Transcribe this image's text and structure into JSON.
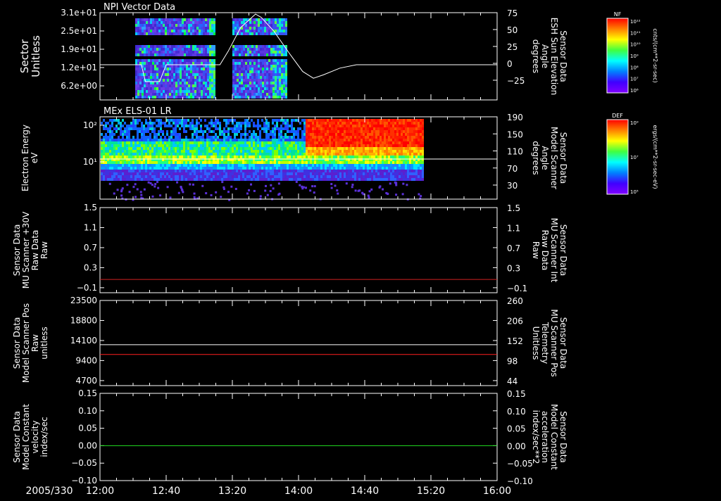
{
  "chart_data": [
    {
      "type": "heatmap",
      "title": "NPI Vector Data",
      "ylabel": [
        "Sector",
        "Unitless"
      ],
      "yticks": [
        "3.1e+01",
        "2.5e+01",
        "1.9e+01",
        "1.2e+01",
        "6.2e+00"
      ],
      "y2ticks": [
        "75",
        "50",
        "25",
        "0",
        "−25"
      ],
      "y2label": [
        "Sensor Data",
        "ESH Sun Elevation",
        "Angle",
        "degrees"
      ],
      "y2color": "#ffffff",
      "colorbar": {
        "title": "NF",
        "ticks": [
          "10¹²",
          "10¹¹",
          "10¹⁰",
          "10⁹",
          "10⁸",
          "10⁷",
          "10⁶"
        ],
        "label": "cnts/(cm**2-sr-sec)"
      },
      "line_series": {
        "name": "ESH Sun Elevation Angle",
        "color": "#ffffff",
        "points": [
          [
            0,
            0
          ],
          [
            50,
            0
          ],
          [
            55,
            -25
          ],
          [
            72,
            -25
          ],
          [
            80,
            0
          ],
          [
            145,
            0
          ],
          [
            155,
            20
          ],
          [
            170,
            55
          ],
          [
            188,
            75
          ],
          [
            195,
            70
          ],
          [
            210,
            50
          ],
          [
            230,
            15
          ],
          [
            245,
            -10
          ],
          [
            258,
            -20
          ],
          [
            270,
            -15
          ],
          [
            290,
            -5
          ],
          [
            310,
            0
          ],
          [
            480,
            0
          ]
        ]
      },
      "time_range_min": [
        720,
        960
      ]
    },
    {
      "type": "heatmap",
      "title": "MEx ELS-01 LR",
      "ylabel": [
        "Electron Energy",
        "eV"
      ],
      "yticks": [
        "10²",
        "10¹"
      ],
      "y2ticks": [
        "190",
        "150",
        "110",
        "70",
        "30"
      ],
      "y2label": [
        "Sensor Data",
        "Model Scanner",
        "Angle",
        "degrees"
      ],
      "y2color": "#ffffff",
      "colorbar": {
        "title": "DEF",
        "ticks": [
          "10⁹",
          "10⁷",
          "10⁵"
        ],
        "label": "ergs/(cm**2-sr-sec-eV)"
      },
      "line_series": {
        "name": "Model Scanner Angle",
        "color": "#ffffff",
        "value": 90,
        "range": [
          10,
          190
        ]
      }
    },
    {
      "type": "line",
      "ylabel": [
        "Sensor Data",
        "MU Scanner +30V",
        "Raw Data",
        "Raw"
      ],
      "yticks": [
        "1.5",
        "1.1",
        "0.7",
        "0.3",
        "−0.1"
      ],
      "y2ticks": [
        "1.5",
        "1.1",
        "0.7",
        "0.3",
        "−0.1"
      ],
      "y2label": [
        "Sensor Data",
        "MU Scanner Int",
        "Raw Data",
        "Raw"
      ],
      "y2color": "#ff2020",
      "ylim": [
        -0.3,
        1.5
      ],
      "series": [
        {
          "color": "#d02020",
          "value": -0.02
        }
      ]
    },
    {
      "type": "line",
      "ylabel": [
        "Sensor Data",
        "Model Scanner Pos",
        "Raw",
        "unitless"
      ],
      "yticks": [
        "23500",
        "18800",
        "14100",
        "9400",
        "4700"
      ],
      "y2ticks": [
        "260",
        "206",
        "152",
        "98",
        "44"
      ],
      "y2label": [
        "Sensor Data",
        "MU Scanner Pos",
        "Telemetry",
        "Unitless"
      ],
      "y2color": "#ff2020",
      "ylim": [
        0,
        23500
      ],
      "series": [
        {
          "color": "#ffffff",
          "value": 11300
        },
        {
          "color": "#ff2020",
          "value": 8600
        }
      ]
    },
    {
      "type": "line",
      "ylabel": [
        "Sensor Data",
        "Model Constant",
        "velocity",
        "index/sec"
      ],
      "yticks": [
        "0.15",
        "0.10",
        "0.05",
        "0.00",
        "−0.05",
        "−0.10"
      ],
      "y2ticks": [
        "0.15",
        "0.10",
        "0.05",
        "0.00",
        "−0.05",
        "−0.10"
      ],
      "y2label": [
        "Sensor Data",
        "Model Constant",
        "acceleration",
        "index/sec**2"
      ],
      "y2color": "#20e020",
      "ylim": [
        -0.1,
        0.15
      ],
      "series": [
        {
          "color": "#20e020",
          "value": 0.0
        }
      ]
    }
  ],
  "xaxis": {
    "date_label": "2005/330",
    "ticks": [
      "12:00",
      "12:40",
      "13:20",
      "14:00",
      "14:40",
      "15:20",
      "16:00"
    ]
  }
}
